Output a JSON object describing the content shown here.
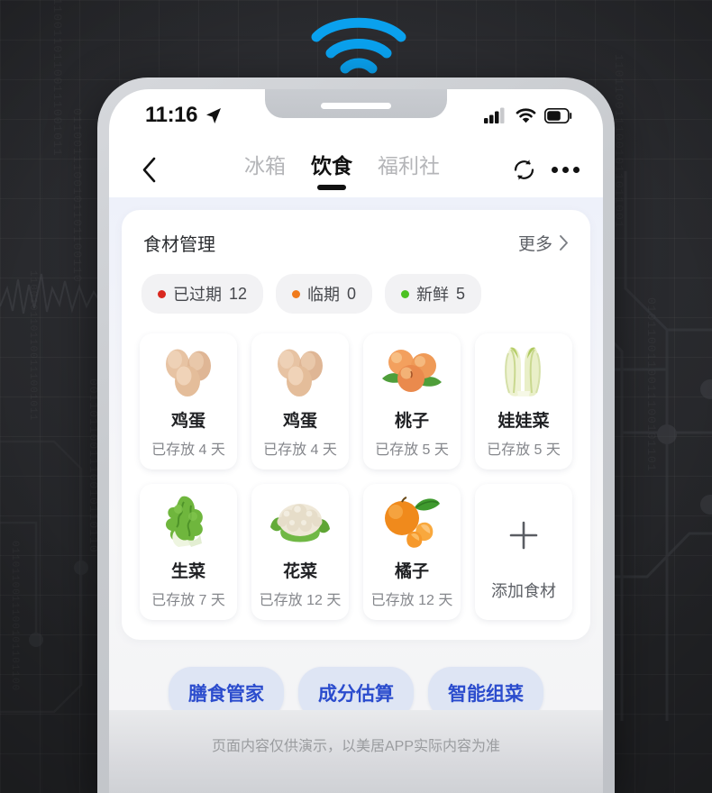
{
  "background": {
    "binary_strings": [
      "1011001101100111001011",
      "0110011100101101100110",
      "1100101101100111001011",
      "0011011001110010110110",
      "1101100111001011011001",
      "0101100110011100101101",
      "1001110010110110011100",
      "0110110011100101101100"
    ]
  },
  "wifi_badge": {
    "icon": "wifi-signal-icon",
    "color": "#0aa1ee"
  },
  "status_bar": {
    "time": "11:16",
    "location_icon": "location-arrow-icon",
    "signal_icon": "cellular-signal-icon",
    "wifi_icon": "wifi-icon",
    "battery_icon": "battery-icon",
    "battery_level": 60
  },
  "nav": {
    "back_icon": "chevron-left-icon",
    "tabs": [
      {
        "label": "冰箱",
        "active": false
      },
      {
        "label": "饮食",
        "active": true
      },
      {
        "label": "福利社",
        "active": false
      }
    ],
    "refresh_icon": "refresh-icon",
    "more_icon": "more-horizontal-icon"
  },
  "panel": {
    "title": "食材管理",
    "more_label": "更多",
    "more_icon": "chevron-right-icon",
    "chips": [
      {
        "label": "已过期",
        "count": "12",
        "color": "#d9281f"
      },
      {
        "label": "临期",
        "count": "0",
        "color": "#f07b1d"
      },
      {
        "label": "新鲜",
        "count": "5",
        "color": "#4cc122"
      }
    ]
  },
  "foods": [
    {
      "name": "鸡蛋",
      "days": "已存放 4 天",
      "icon": "eggs-image"
    },
    {
      "name": "鸡蛋",
      "days": "已存放 4 天",
      "icon": "eggs-image"
    },
    {
      "name": "桃子",
      "days": "已存放 5 天",
      "icon": "peaches-image"
    },
    {
      "name": "娃娃菜",
      "days": "已存放 5 天",
      "icon": "baby-cabbage-image"
    },
    {
      "name": "生菜",
      "days": "已存放 7 天",
      "icon": "lettuce-image"
    },
    {
      "name": "花菜",
      "days": "已存放 12 天",
      "icon": "cauliflower-image"
    },
    {
      "name": "橘子",
      "days": "已存放 12 天",
      "icon": "orange-image"
    }
  ],
  "add_card": {
    "label": "添加食材",
    "icon": "plus-icon"
  },
  "actions": [
    {
      "label": "膳食管家"
    },
    {
      "label": "成分估算"
    },
    {
      "label": "智能组菜"
    }
  ],
  "disclaimer": "页面内容仅供演示，以美居APP实际内容为准",
  "colors": {
    "accent_blue": "#2b4ccd",
    "button_bg": "#dee5f4",
    "wifi_blue": "#0aa1ee"
  }
}
